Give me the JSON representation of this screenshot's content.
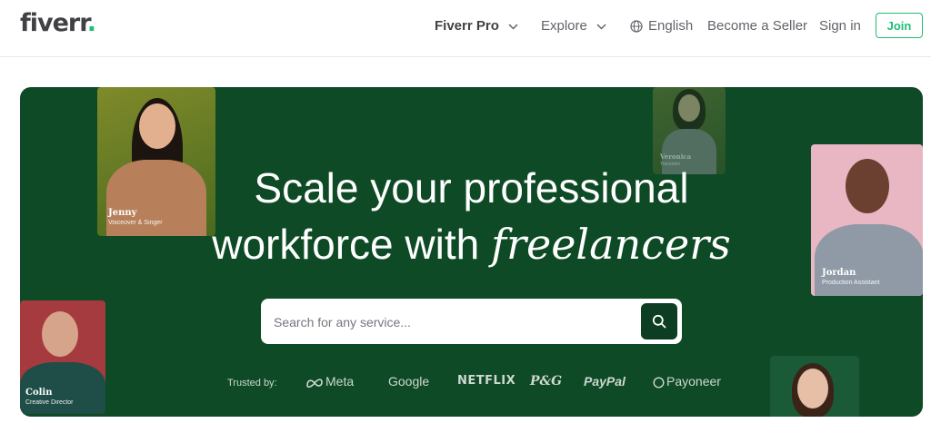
{
  "header": {
    "logo": "fiverr",
    "logo_dot": ".",
    "nav": {
      "fiverr_pro": "Fiverr Pro",
      "explore": "Explore",
      "language": "English",
      "become_seller": "Become a Seller",
      "sign_in": "Sign in",
      "join": "Join"
    }
  },
  "hero": {
    "headline_line1": "Scale your professional",
    "headline_line2_prefix": "workforce with ",
    "headline_line2_italic": "freelancers",
    "search": {
      "placeholder": "Search for any service..."
    },
    "trusted_label": "Trusted by:",
    "brands": [
      "Meta",
      "Google",
      "NETFLIX",
      "P&G",
      "PayPal",
      "Payoneer"
    ],
    "cards": [
      {
        "name": "Jenny",
        "role": "Voiceover & Singer"
      },
      {
        "name": "Veronica",
        "role": "Translator"
      },
      {
        "name": "Jordan",
        "role": "Production Assistant"
      },
      {
        "name": "Colin",
        "role": "Creative Director"
      }
    ]
  },
  "colors": {
    "brand_green": "#1dbf73",
    "hero_bg": "#0d4a25",
    "search_btn": "#0d3d22"
  },
  "icons": [
    "chevron-down-icon",
    "globe-icon",
    "search-icon",
    "meta-icon",
    "payoneer-icon"
  ]
}
